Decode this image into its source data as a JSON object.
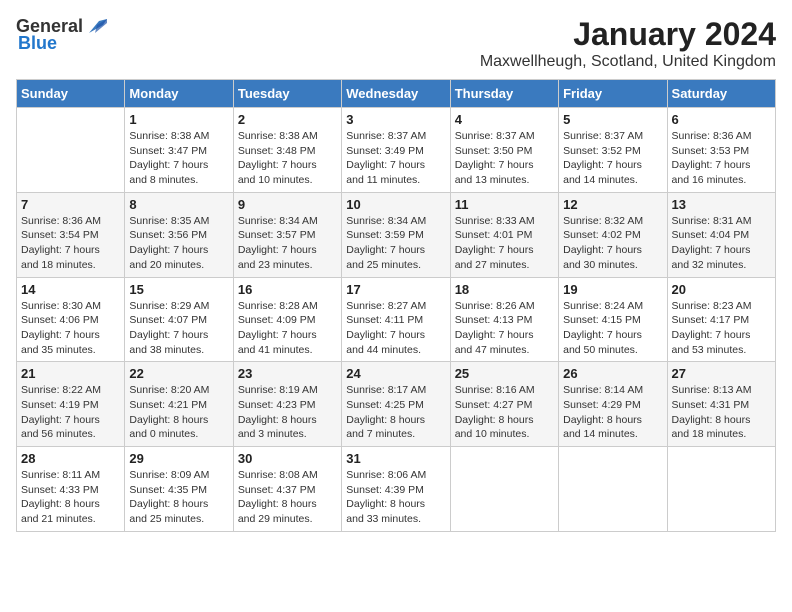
{
  "logo": {
    "text_general": "General",
    "text_blue": "Blue"
  },
  "title": {
    "month": "January 2024",
    "location": "Maxwellheugh, Scotland, United Kingdom"
  },
  "headers": [
    "Sunday",
    "Monday",
    "Tuesday",
    "Wednesday",
    "Thursday",
    "Friday",
    "Saturday"
  ],
  "weeks": [
    [
      {
        "day": "",
        "content": ""
      },
      {
        "day": "1",
        "content": "Sunrise: 8:38 AM\nSunset: 3:47 PM\nDaylight: 7 hours\nand 8 minutes."
      },
      {
        "day": "2",
        "content": "Sunrise: 8:38 AM\nSunset: 3:48 PM\nDaylight: 7 hours\nand 10 minutes."
      },
      {
        "day": "3",
        "content": "Sunrise: 8:37 AM\nSunset: 3:49 PM\nDaylight: 7 hours\nand 11 minutes."
      },
      {
        "day": "4",
        "content": "Sunrise: 8:37 AM\nSunset: 3:50 PM\nDaylight: 7 hours\nand 13 minutes."
      },
      {
        "day": "5",
        "content": "Sunrise: 8:37 AM\nSunset: 3:52 PM\nDaylight: 7 hours\nand 14 minutes."
      },
      {
        "day": "6",
        "content": "Sunrise: 8:36 AM\nSunset: 3:53 PM\nDaylight: 7 hours\nand 16 minutes."
      }
    ],
    [
      {
        "day": "7",
        "content": "Sunrise: 8:36 AM\nSunset: 3:54 PM\nDaylight: 7 hours\nand 18 minutes."
      },
      {
        "day": "8",
        "content": "Sunrise: 8:35 AM\nSunset: 3:56 PM\nDaylight: 7 hours\nand 20 minutes."
      },
      {
        "day": "9",
        "content": "Sunrise: 8:34 AM\nSunset: 3:57 PM\nDaylight: 7 hours\nand 23 minutes."
      },
      {
        "day": "10",
        "content": "Sunrise: 8:34 AM\nSunset: 3:59 PM\nDaylight: 7 hours\nand 25 minutes."
      },
      {
        "day": "11",
        "content": "Sunrise: 8:33 AM\nSunset: 4:01 PM\nDaylight: 7 hours\nand 27 minutes."
      },
      {
        "day": "12",
        "content": "Sunrise: 8:32 AM\nSunset: 4:02 PM\nDaylight: 7 hours\nand 30 minutes."
      },
      {
        "day": "13",
        "content": "Sunrise: 8:31 AM\nSunset: 4:04 PM\nDaylight: 7 hours\nand 32 minutes."
      }
    ],
    [
      {
        "day": "14",
        "content": "Sunrise: 8:30 AM\nSunset: 4:06 PM\nDaylight: 7 hours\nand 35 minutes."
      },
      {
        "day": "15",
        "content": "Sunrise: 8:29 AM\nSunset: 4:07 PM\nDaylight: 7 hours\nand 38 minutes."
      },
      {
        "day": "16",
        "content": "Sunrise: 8:28 AM\nSunset: 4:09 PM\nDaylight: 7 hours\nand 41 minutes."
      },
      {
        "day": "17",
        "content": "Sunrise: 8:27 AM\nSunset: 4:11 PM\nDaylight: 7 hours\nand 44 minutes."
      },
      {
        "day": "18",
        "content": "Sunrise: 8:26 AM\nSunset: 4:13 PM\nDaylight: 7 hours\nand 47 minutes."
      },
      {
        "day": "19",
        "content": "Sunrise: 8:24 AM\nSunset: 4:15 PM\nDaylight: 7 hours\nand 50 minutes."
      },
      {
        "day": "20",
        "content": "Sunrise: 8:23 AM\nSunset: 4:17 PM\nDaylight: 7 hours\nand 53 minutes."
      }
    ],
    [
      {
        "day": "21",
        "content": "Sunrise: 8:22 AM\nSunset: 4:19 PM\nDaylight: 7 hours\nand 56 minutes."
      },
      {
        "day": "22",
        "content": "Sunrise: 8:20 AM\nSunset: 4:21 PM\nDaylight: 8 hours\nand 0 minutes."
      },
      {
        "day": "23",
        "content": "Sunrise: 8:19 AM\nSunset: 4:23 PM\nDaylight: 8 hours\nand 3 minutes."
      },
      {
        "day": "24",
        "content": "Sunrise: 8:17 AM\nSunset: 4:25 PM\nDaylight: 8 hours\nand 7 minutes."
      },
      {
        "day": "25",
        "content": "Sunrise: 8:16 AM\nSunset: 4:27 PM\nDaylight: 8 hours\nand 10 minutes."
      },
      {
        "day": "26",
        "content": "Sunrise: 8:14 AM\nSunset: 4:29 PM\nDaylight: 8 hours\nand 14 minutes."
      },
      {
        "day": "27",
        "content": "Sunrise: 8:13 AM\nSunset: 4:31 PM\nDaylight: 8 hours\nand 18 minutes."
      }
    ],
    [
      {
        "day": "28",
        "content": "Sunrise: 8:11 AM\nSunset: 4:33 PM\nDaylight: 8 hours\nand 21 minutes."
      },
      {
        "day": "29",
        "content": "Sunrise: 8:09 AM\nSunset: 4:35 PM\nDaylight: 8 hours\nand 25 minutes."
      },
      {
        "day": "30",
        "content": "Sunrise: 8:08 AM\nSunset: 4:37 PM\nDaylight: 8 hours\nand 29 minutes."
      },
      {
        "day": "31",
        "content": "Sunrise: 8:06 AM\nSunset: 4:39 PM\nDaylight: 8 hours\nand 33 minutes."
      },
      {
        "day": "",
        "content": ""
      },
      {
        "day": "",
        "content": ""
      },
      {
        "day": "",
        "content": ""
      }
    ]
  ]
}
